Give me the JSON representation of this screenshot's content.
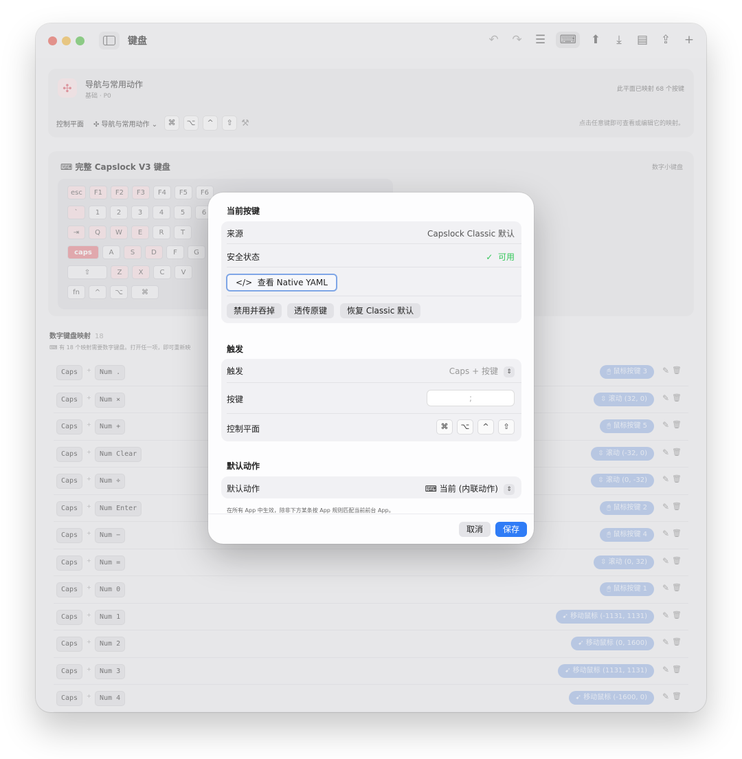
{
  "window": {
    "title": "键盘"
  },
  "toolbar": {
    "icons": [
      {
        "name": "undo-icon",
        "glyph": "↶",
        "dim": true
      },
      {
        "name": "redo-icon",
        "glyph": "↷",
        "dim": true
      },
      {
        "name": "list-view-icon",
        "glyph": "☰",
        "dim": false
      },
      {
        "name": "keyboard-view-icon",
        "glyph": "⌨",
        "dim": false,
        "seg": true
      },
      {
        "name": "upload-icon",
        "glyph": "⬆",
        "dim": false
      },
      {
        "name": "import-icon",
        "glyph": "⤓",
        "dim": false
      },
      {
        "name": "document-icon",
        "glyph": "▤",
        "dim": false
      },
      {
        "name": "share-icon",
        "glyph": "⇪",
        "dim": false
      },
      {
        "name": "add-icon",
        "glyph": "+",
        "dim": false
      }
    ]
  },
  "layer_card": {
    "title": "导航与常用动作",
    "subtitle": "基础 · P0",
    "mapped_count": "此平面已映射 68 个按键",
    "control_plane_label": "控制平面",
    "layer_dropdown": "✣ 导航与常用动作 ⌄",
    "modifier_keys": [
      "⌘",
      "⌥",
      "^",
      "⇧"
    ],
    "hint": "点击任意键即可查看或编辑它的映射。"
  },
  "keyboard_card": {
    "title": "完整 Capslock V3 键盘",
    "right_label": "数字小键盘",
    "rows": [
      [
        {
          "t": "esc",
          "p": true
        },
        {
          "t": "F1",
          "p": true
        },
        {
          "t": "F2",
          "p": true
        },
        {
          "t": "F3",
          "p": true
        },
        {
          "t": "F4"
        },
        {
          "t": "F5"
        },
        {
          "t": "F6"
        }
      ],
      [
        {
          "t": "`",
          "p": true
        },
        {
          "t": "1"
        },
        {
          "t": "2"
        },
        {
          "t": "3"
        },
        {
          "t": "4"
        },
        {
          "t": "5"
        },
        {
          "t": "6"
        }
      ],
      [
        {
          "t": "⇥",
          "p": true
        },
        {
          "t": "Q",
          "p": true
        },
        {
          "t": "W",
          "p": true
        },
        {
          "t": "E",
          "p": true
        },
        {
          "t": "R"
        },
        {
          "t": "T"
        }
      ],
      [
        {
          "t": "caps",
          "c": true
        },
        {
          "t": "A"
        },
        {
          "t": "S",
          "p": true
        },
        {
          "t": "D",
          "p": true
        },
        {
          "t": "F"
        },
        {
          "t": "G"
        }
      ],
      [
        {
          "t": "⇧",
          "w": 58
        },
        {
          "t": "Z",
          "p": true
        },
        {
          "t": "X",
          "p": true
        },
        {
          "t": "C"
        },
        {
          "t": "V"
        }
      ],
      [
        {
          "t": "fn"
        },
        {
          "t": "^"
        },
        {
          "t": "⌥"
        },
        {
          "t": "⌘",
          "w": 40
        }
      ]
    ]
  },
  "numpad_section": {
    "title": "数字键盘映射",
    "count": "18",
    "note": "有 18 个映射需要数字键盘。打开任一项，即可重新映"
  },
  "mappings": [
    {
      "caps": "Caps",
      "key": "Num .",
      "action": "🖰 鼠标按键 3"
    },
    {
      "caps": "Caps",
      "key": "Num ×",
      "action": "⇳ 滚动 (32, 0)"
    },
    {
      "caps": "Caps",
      "key": "Num +",
      "action": "🖰 鼠标按键 5"
    },
    {
      "caps": "Caps",
      "key": "Num Clear",
      "action": "⇳ 滚动 (-32, 0)"
    },
    {
      "caps": "Caps",
      "key": "Num ÷",
      "action": "⇳ 滚动 (0, -32)"
    },
    {
      "caps": "Caps",
      "key": "Num Enter",
      "action": "🖰 鼠标按键 2"
    },
    {
      "caps": "Caps",
      "key": "Num −",
      "action": "🖰 鼠标按键 4"
    },
    {
      "caps": "Caps",
      "key": "Num =",
      "action": "⇳ 滚动 (0, 32)"
    },
    {
      "caps": "Caps",
      "key": "Num 0",
      "action": "🖰 鼠标按键 1"
    },
    {
      "caps": "Caps",
      "key": "Num 1",
      "action": "➹ 移动鼠标 (-1131, 1131)"
    },
    {
      "caps": "Caps",
      "key": "Num 2",
      "action": "➹ 移动鼠标 (0, 1600)"
    },
    {
      "caps": "Caps",
      "key": "Num 3",
      "action": "➹ 移动鼠标 (1131, 1131)"
    },
    {
      "caps": "Caps",
      "key": "Num 4",
      "action": "➹ 移动鼠标 (-1600, 0)"
    }
  ],
  "modal": {
    "section_current": "当前按键",
    "source_label": "来源",
    "source_value": "Capslock Classic 默认",
    "safety_label": "安全状态",
    "safety_value": "可用",
    "yaml_button": "查看 Native YAML",
    "disable_button": "禁用并吞掉",
    "passthrough_button": "透传原键",
    "restore_button": "恢复 Classic 默认",
    "section_trigger": "触发",
    "trigger_label": "触发",
    "trigger_value": "Caps + 按键",
    "key_label": "按键",
    "key_value": ";",
    "control_plane_label": "控制平面",
    "control_keys": [
      "⌘",
      "⌥",
      "^",
      "⇧"
    ],
    "section_default": "默认动作",
    "default_label": "默认动作",
    "default_value": "⌨ 当前 (内联动作)",
    "note": "在所有 App 中生效，除非下方某条按 App 规则匹配当前前台 App。",
    "cancel": "取消",
    "save": "保存"
  }
}
